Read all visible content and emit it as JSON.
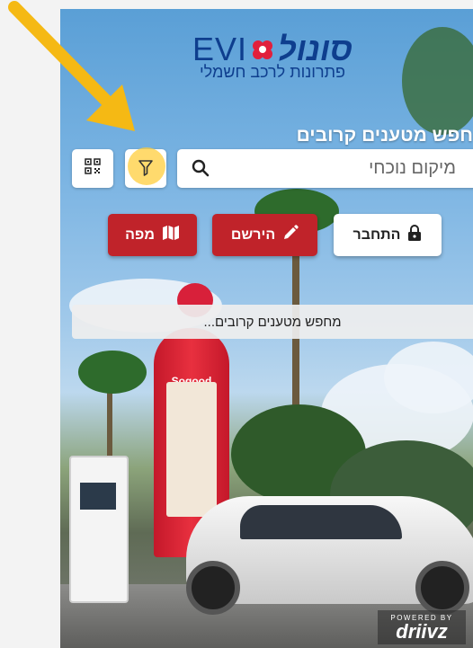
{
  "logo": {
    "evi": "EVI",
    "brand": "סונול",
    "subtitle": "פתרונות לרכב חשמלי"
  },
  "title": "חפש מטענים קרובים",
  "search": {
    "placeholder": "מיקום נוכחי"
  },
  "buttons": {
    "login": "התחבר",
    "register": "הירשם",
    "map": "מפה"
  },
  "status": "מחפש מטענים קרובים...",
  "pylon": {
    "label": "Sogood"
  },
  "powered": {
    "small": "POWERED BY",
    "brand": "driivz"
  },
  "colors": {
    "accent": "#c0232a",
    "brand_blue": "#0e3e8e",
    "highlight": "#ffc83c"
  }
}
